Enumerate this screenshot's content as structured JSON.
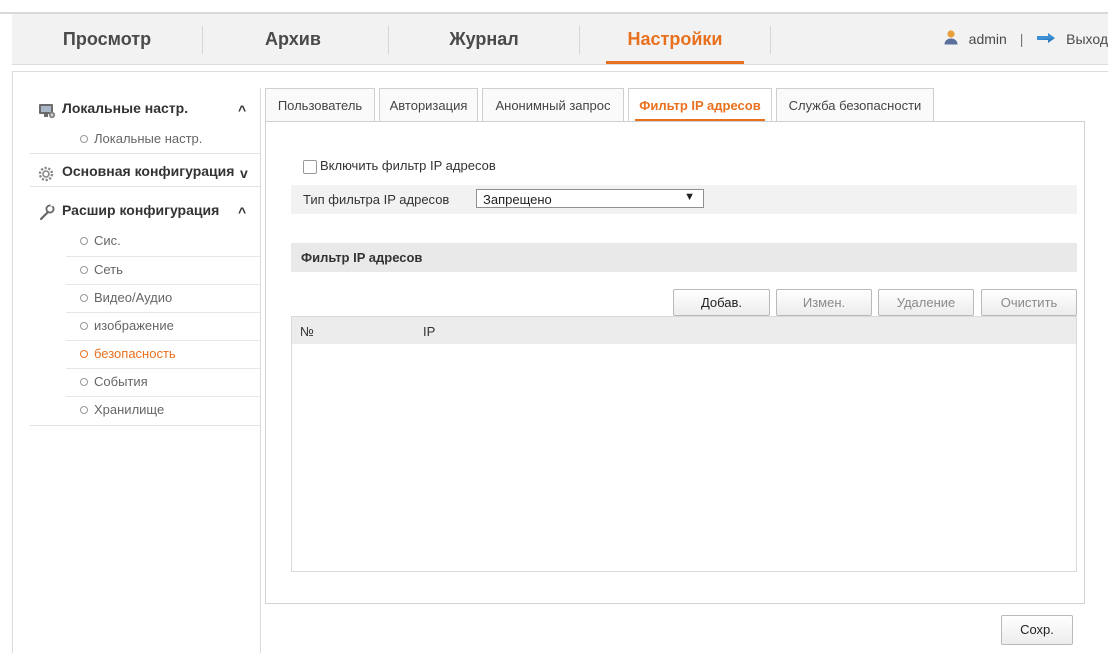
{
  "nav": {
    "items": [
      "Просмотр",
      "Архив",
      "Журнал",
      "Настройки"
    ],
    "active": "Настройки",
    "user": "admin",
    "separator": "|",
    "logout": "Выход"
  },
  "sidebar": {
    "sections": [
      {
        "label": "Локальные настр.",
        "icon": "monitor-icon",
        "state": "expanded",
        "chevron": "^",
        "items": [
          "Локальные настр."
        ]
      },
      {
        "label": "Основная конфигурация",
        "icon": "gear-icon",
        "state": "collapsed",
        "chevron": "v",
        "items": []
      },
      {
        "label": "Расшир конфигурация",
        "icon": "wrench-icon",
        "state": "expanded",
        "chevron": "^",
        "items": [
          "Сис.",
          "Сеть",
          "Видео/Аудио",
          "изображение",
          "безопасность",
          "События",
          "Хранилище"
        ]
      }
    ],
    "active_item": "безопасность"
  },
  "tabs": {
    "items": [
      "Пользователь",
      "Авторизация",
      "Анонимный запрос",
      "Фильтр IP адресов",
      "Служба безопасности"
    ],
    "active": "Фильтр IP адресов"
  },
  "form": {
    "enable_label": "Включить фильтр IP адресов",
    "enable_checked": false,
    "filter_type_label": "Тип фильтра IP адресов",
    "filter_type_value": "Запрещено",
    "select_arrow": "▼"
  },
  "section": {
    "title": "Фильтр IP адресов"
  },
  "buttons": {
    "add": "Добав.",
    "edit": "Измен.",
    "delete": "Удаление",
    "clear": "Очистить",
    "save": "Сохр."
  },
  "table": {
    "columns": [
      "№",
      "IP"
    ],
    "rows": []
  },
  "colors": {
    "accent": "#e8701e",
    "nav_bg": "#f2f2f2",
    "section_bg": "#e9e9e9"
  }
}
